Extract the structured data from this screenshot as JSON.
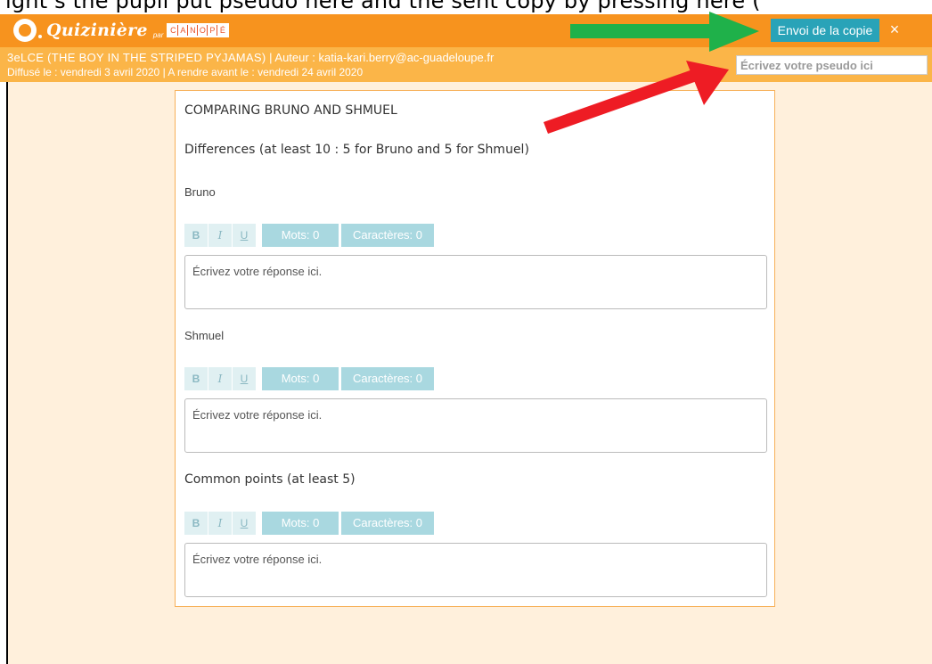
{
  "top_strip": {
    "text": "ight s the pupil put pseudo here and the sent copy by pressing here ("
  },
  "brand": {
    "name": "Quizinière",
    "par": "par",
    "canope_letters": [
      "C",
      "A",
      "N",
      "O",
      "P",
      "É"
    ]
  },
  "header": {
    "send_label": "Envoi de la copie",
    "close_label": "×"
  },
  "meta": {
    "title": "3eLCE (THE BOY IN THE STRIPED PYJAMAS)",
    "author": "| Auteur : katia-kari.berry@ac-guadeloupe.fr",
    "diffused": "Diffusé le : vendredi 3 avril 2020",
    "deadline": "| A rendre avant le : vendredi 24 avril 2020",
    "pseudo_placeholder": "Écrivez votre pseudo ici"
  },
  "card": {
    "title": "COMPARING BRUNO AND SHMUEL",
    "differences_label": "Differences (at least 10 : 5 for Bruno and 5 for Shmuel)",
    "common_label": "Common points (at least 5)",
    "questions": [
      {
        "label": "Bruno",
        "bold": "B",
        "italic": "I",
        "underline": "U",
        "words": "Mots: 0",
        "chars": "Caractères: 0",
        "placeholder": "Écrivez votre réponse ici."
      },
      {
        "label": "Shmuel",
        "bold": "B",
        "italic": "I",
        "underline": "U",
        "words": "Mots: 0",
        "chars": "Caractères: 0",
        "placeholder": "Écrivez votre réponse ici."
      },
      {
        "label": "",
        "bold": "B",
        "italic": "I",
        "underline": "U",
        "words": "Mots: 0",
        "chars": "Caractères: 0",
        "placeholder": "Écrivez votre réponse ici."
      }
    ]
  },
  "colors": {
    "orange": "#f7931e",
    "light_orange": "#fbb548",
    "teal": "#29a3b8",
    "green_arrow": "#1fb14a",
    "red_arrow": "#ee1c24"
  }
}
